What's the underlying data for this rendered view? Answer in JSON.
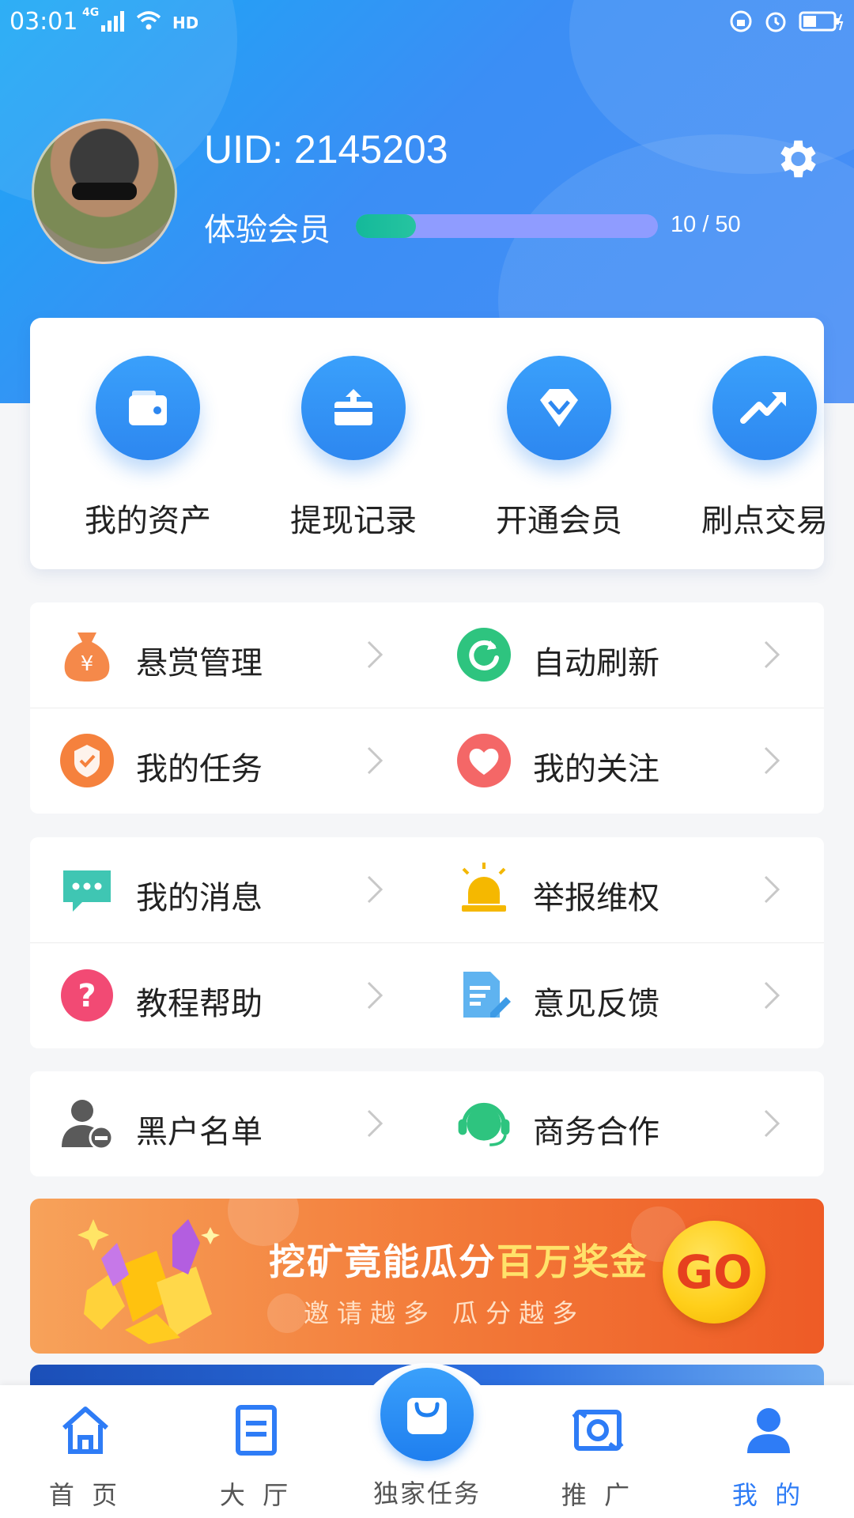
{
  "status_bar": {
    "time": "03:01",
    "network": "4G"
  },
  "profile": {
    "uid": "UID: 2145203",
    "level_label": "体验会员",
    "progress_text": "10 / 50",
    "progress_fraction": 0.2
  },
  "quick_actions": [
    {
      "label": "我的资产",
      "icon": "wallet-icon"
    },
    {
      "label": "提现记录",
      "icon": "withdraw-icon"
    },
    {
      "label": "开通会员",
      "icon": "diamond-icon"
    },
    {
      "label": "刷点交易",
      "icon": "trend-up-icon"
    }
  ],
  "menu_groups": [
    [
      [
        {
          "label": "悬赏管理",
          "icon": "money-bag-icon"
        },
        {
          "label": "自动刷新",
          "icon": "refresh-icon"
        }
      ],
      [
        {
          "label": "我的任务",
          "icon": "task-shield-icon"
        },
        {
          "label": "我的关注",
          "icon": "heart-icon"
        }
      ]
    ],
    [
      [
        {
          "label": "我的消息",
          "icon": "message-icon"
        },
        {
          "label": "举报维权",
          "icon": "alarm-icon"
        }
      ],
      [
        {
          "label": "教程帮助",
          "icon": "help-icon"
        },
        {
          "label": "意见反馈",
          "icon": "feedback-icon"
        }
      ]
    ],
    [
      [
        {
          "label": "黑户名单",
          "icon": "blacklist-user-icon"
        },
        {
          "label": "商务合作",
          "icon": "headset-icon"
        }
      ]
    ]
  ],
  "banner": {
    "title_part1": "挖矿竟能瓜分",
    "title_part2": "百万奖金",
    "subtitle": "邀请越多 瓜分越多",
    "go_label": "GO"
  },
  "bottom_nav": {
    "home": "首 页",
    "hall": "大 厅",
    "center": "独家任务",
    "promote": "推 广",
    "mine": "我 的",
    "active": "mine"
  },
  "colors": {
    "accent": "#2e7cf6",
    "header_start": "#1aa8f5",
    "header_end": "#4a8ef6",
    "progress_fill": "#14b99a",
    "progress_track": "#8f9cff",
    "banner_orange": "#f37c3a",
    "go_yellow": "#ffcf1a"
  }
}
